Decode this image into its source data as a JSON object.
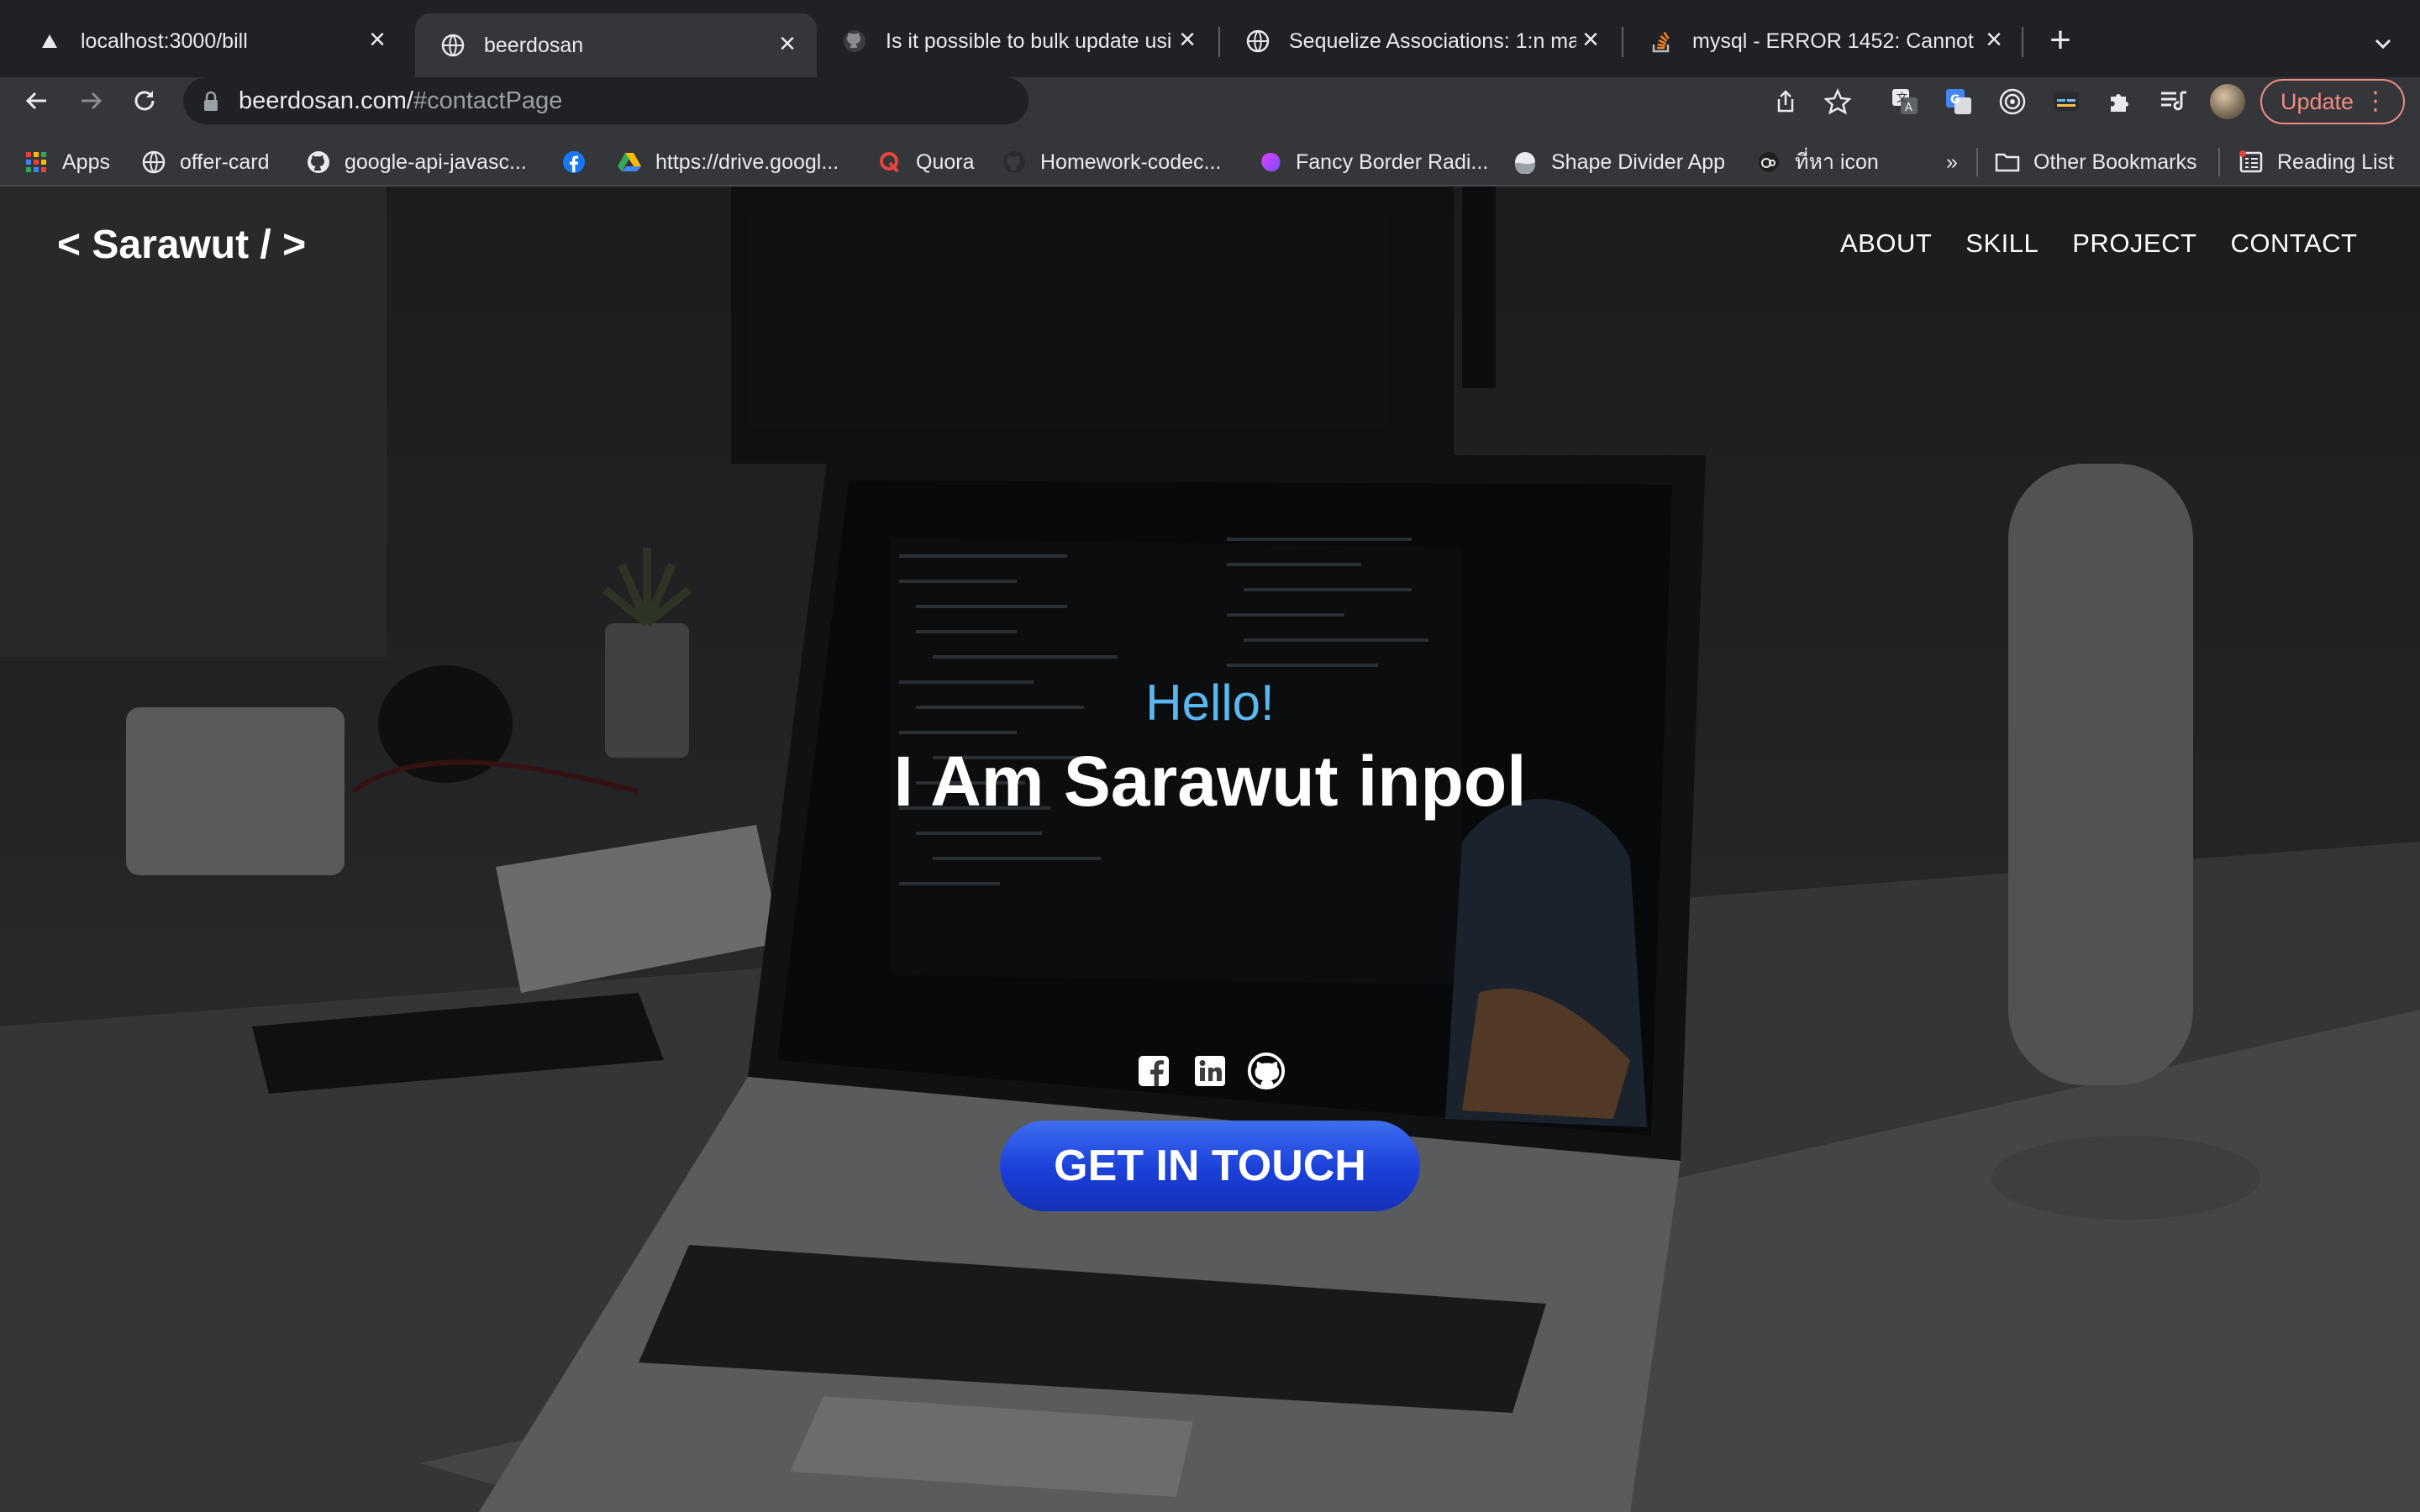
{
  "browser": {
    "tabs": [
      {
        "title": "localhost:3000/bill",
        "favicon": "triangle-icon",
        "active": false
      },
      {
        "title": "beerdosan",
        "favicon": "globe-icon",
        "active": true
      },
      {
        "title": "Is it possible to bulk update usi",
        "favicon": "github-icon",
        "active": false
      },
      {
        "title": "Sequelize Associations: 1:n ma",
        "favicon": "globe-icon",
        "active": false
      },
      {
        "title": "mysql - ERROR 1452: Cannot a",
        "favicon": "stackoverflow-icon",
        "active": false
      }
    ],
    "new_tab_label": "+",
    "url_host": "beerdosan.com/",
    "url_path": "#contactPage",
    "update_label": "Update",
    "bookmarks": [
      {
        "label": "Apps",
        "icon": "apps-grid-icon"
      },
      {
        "label": "offer-card",
        "icon": "globe-icon"
      },
      {
        "label": "google-api-javasc...",
        "icon": "github-icon"
      },
      {
        "label": "",
        "icon": "facebook-icon"
      },
      {
        "label": "https://drive.googl...",
        "icon": "google-drive-icon"
      },
      {
        "label": "Quora",
        "icon": "quora-icon"
      },
      {
        "label": "Homework-codec...",
        "icon": "github-icon"
      },
      {
        "label": "Fancy Border Radi...",
        "icon": "blob-icon"
      },
      {
        "label": "Shape Divider App",
        "icon": "shape-icon"
      },
      {
        "label": "ที่หา icon",
        "icon": "icon-finder-icon"
      }
    ],
    "bookmarks_overflow": "»",
    "other_bookmarks": "Other Bookmarks",
    "reading_list": "Reading List"
  },
  "site": {
    "logo": "< Sarawut / >",
    "nav": [
      "ABOUT",
      "SKILL",
      "PROJECT",
      "CONTACT"
    ],
    "hero": {
      "greeting": "Hello!",
      "headline": "I Am Sarawut inpol",
      "socials": [
        "facebook-icon",
        "linkedin-icon",
        "github-icon"
      ],
      "cta_label": "GET IN TOUCH"
    },
    "colors": {
      "greeting": "#5ab8f0",
      "cta": "#2446e0",
      "update_accent": "#f28b82"
    }
  }
}
